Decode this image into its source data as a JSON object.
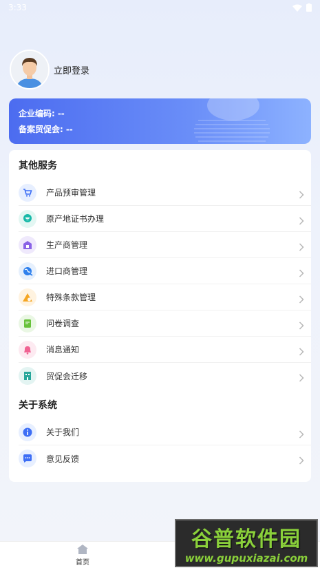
{
  "status_bar": {
    "time": "3:33"
  },
  "profile": {
    "login_text": "立即登录"
  },
  "company": {
    "code_label": "企业编码:",
    "code_value": "--",
    "chamber_label": "备案贸促会:",
    "chamber_value": "--"
  },
  "services": {
    "title": "其他服务",
    "items": [
      {
        "label": "产品预审管理",
        "icon": "cart-icon",
        "color": "#3d6ef5",
        "bg": "#e7efff"
      },
      {
        "label": "原产地证书办理",
        "icon": "certificate-icon",
        "color": "#18b9a8",
        "bg": "#e3f7f3"
      },
      {
        "label": "生产商管理",
        "icon": "factory-icon",
        "color": "#8a63e6",
        "bg": "#efe9fc"
      },
      {
        "label": "进口商管理",
        "icon": "globe-icon",
        "color": "#2f80ed",
        "bg": "#e6f0fd"
      },
      {
        "label": "特殊条款管理",
        "icon": "warning-icon",
        "color": "#f5a623",
        "bg": "#fff3e0"
      },
      {
        "label": "问卷调查",
        "icon": "survey-icon",
        "color": "#67c23a",
        "bg": "#eaf7e4"
      },
      {
        "label": "消息通知",
        "icon": "bell-icon",
        "color": "#f06292",
        "bg": "#fdeaf1"
      },
      {
        "label": "贸促会迁移",
        "icon": "building-icon",
        "color": "#26a69a",
        "bg": "#e3f4f2"
      }
    ]
  },
  "system": {
    "title": "关于系统",
    "items": [
      {
        "label": "关于我们",
        "icon": "info-icon",
        "color": "#3d6ef5",
        "bg": "#e7efff"
      },
      {
        "label": "意见反馈",
        "icon": "feedback-icon",
        "color": "#3d6ef5",
        "bg": "#e7efff"
      }
    ]
  },
  "nav": {
    "home_label": "首页"
  },
  "watermark": {
    "big": "谷普软件园",
    "small": "www.gupuxiazai.com"
  }
}
